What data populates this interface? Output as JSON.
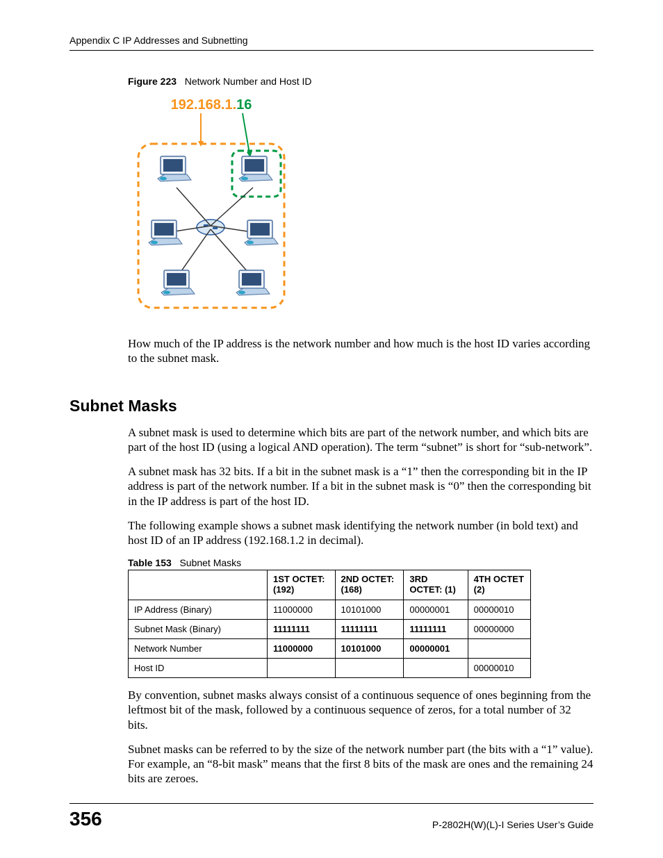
{
  "header": {
    "text": "Appendix C IP Addresses and Subnetting"
  },
  "figure": {
    "label": "Figure 223",
    "caption": "Network Number and Host ID",
    "ip_network": "192.168.1.",
    "ip_host": "16"
  },
  "paragraphs": {
    "p1": "How much of the IP address is the network number and how much is the host ID varies according to the subnet mask.",
    "p2": "A subnet mask is used to determine which bits are part of the network number, and which bits are part of the host ID (using a logical AND operation). The term “subnet” is short for “sub-network”.",
    "p3": "A subnet mask has 32 bits. If a bit in the subnet mask is a “1” then the corresponding bit in the IP address is part of the network number. If a bit in the subnet mask is “0” then the corresponding bit in the IP address is part of the host ID.",
    "p4": "The following example shows a subnet mask identifying the network number (in bold text) and host ID of an IP address (192.168.1.2 in decimal).",
    "p5": "By convention, subnet masks always consist of a continuous sequence of ones beginning from the leftmost bit of the mask, followed by a continuous sequence of zeros, for a total number of 32 bits.",
    "p6": "Subnet masks can be referred to by the size of the network number part (the bits with a “1” value). For example, an “8-bit mask” means that the first 8 bits of the mask are ones and the remaining 24 bits are zeroes."
  },
  "section": {
    "title": "Subnet Masks"
  },
  "table": {
    "label": "Table 153",
    "caption": "Subnet Masks",
    "headers": {
      "c0": "",
      "c1": "1ST OCTET: (192)",
      "c2": "2ND OCTET: (168)",
      "c3": "3RD OCTET: (1)",
      "c4": "4TH OCTET (2)"
    },
    "rows": [
      {
        "label": "IP Address (Binary)",
        "c1": "11000000",
        "c2": "10101000",
        "c3": "00000001",
        "c4": "00000010",
        "bold": [
          false,
          false,
          false,
          false,
          false
        ]
      },
      {
        "label": "Subnet Mask (Binary)",
        "c1": "11111111",
        "c2": "11111111",
        "c3": "11111111",
        "c4": "00000000",
        "bold": [
          false,
          true,
          true,
          true,
          false
        ]
      },
      {
        "label": "Network Number",
        "c1": "11000000",
        "c2": "10101000",
        "c3": "00000001",
        "c4": "",
        "bold": [
          false,
          true,
          true,
          true,
          false
        ]
      },
      {
        "label": "Host ID",
        "c1": "",
        "c2": "",
        "c3": "",
        "c4": "00000010",
        "bold": [
          false,
          false,
          false,
          false,
          false
        ]
      }
    ]
  },
  "footer": {
    "page": "356",
    "guide": "P-2802H(W)(L)-I Series User’s Guide"
  }
}
